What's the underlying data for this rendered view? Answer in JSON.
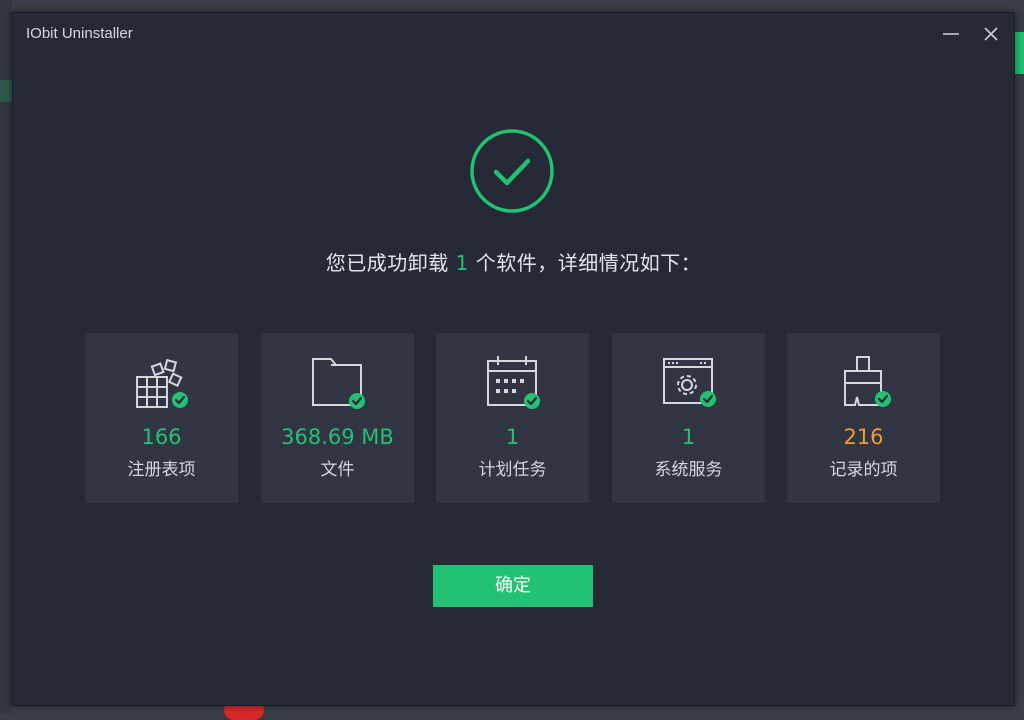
{
  "window": {
    "title": "IObit Uninstaller"
  },
  "headline": {
    "prefix": "您已成功卸载",
    "count": "1",
    "suffix": "个软件，详细情况如下："
  },
  "cards": [
    {
      "value": "166",
      "label": "注册表项",
      "icon": "registry-blocks-icon",
      "color": "#23c272"
    },
    {
      "value": "368.69 MB",
      "label": "文件",
      "icon": "folder-icon",
      "color": "#23c272"
    },
    {
      "value": "1",
      "label": "计划任务",
      "icon": "calendar-icon",
      "color": "#23c272"
    },
    {
      "value": "1",
      "label": "系统服务",
      "icon": "service-gear-window-icon",
      "color": "#23c272"
    },
    {
      "value": "216",
      "label": "记录的项",
      "icon": "broom-icon",
      "color": "#f29b30"
    }
  ],
  "ok_button": {
    "label": "确定"
  },
  "colors": {
    "accent": "#23c272",
    "orange": "#f29b30",
    "background": "#262936",
    "card": "#323543"
  }
}
